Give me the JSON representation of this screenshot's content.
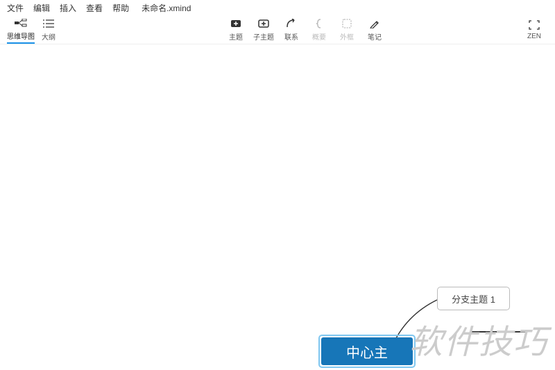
{
  "menu": {
    "file": "文件",
    "edit": "编辑",
    "insert": "插入",
    "view": "查看",
    "help": "帮助",
    "filename": "未命名.xmind"
  },
  "toolbar": {
    "mindmap": "思维导图",
    "outline": "大纲",
    "topic": "主题",
    "subtopic": "子主题",
    "relationship": "联系",
    "summary": "概要",
    "boundary": "外框",
    "notes": "笔记",
    "zen": "ZEN"
  },
  "canvas": {
    "central_topic": "中心主",
    "branch_topic": "分支主题 1"
  },
  "watermark": "软件技巧"
}
